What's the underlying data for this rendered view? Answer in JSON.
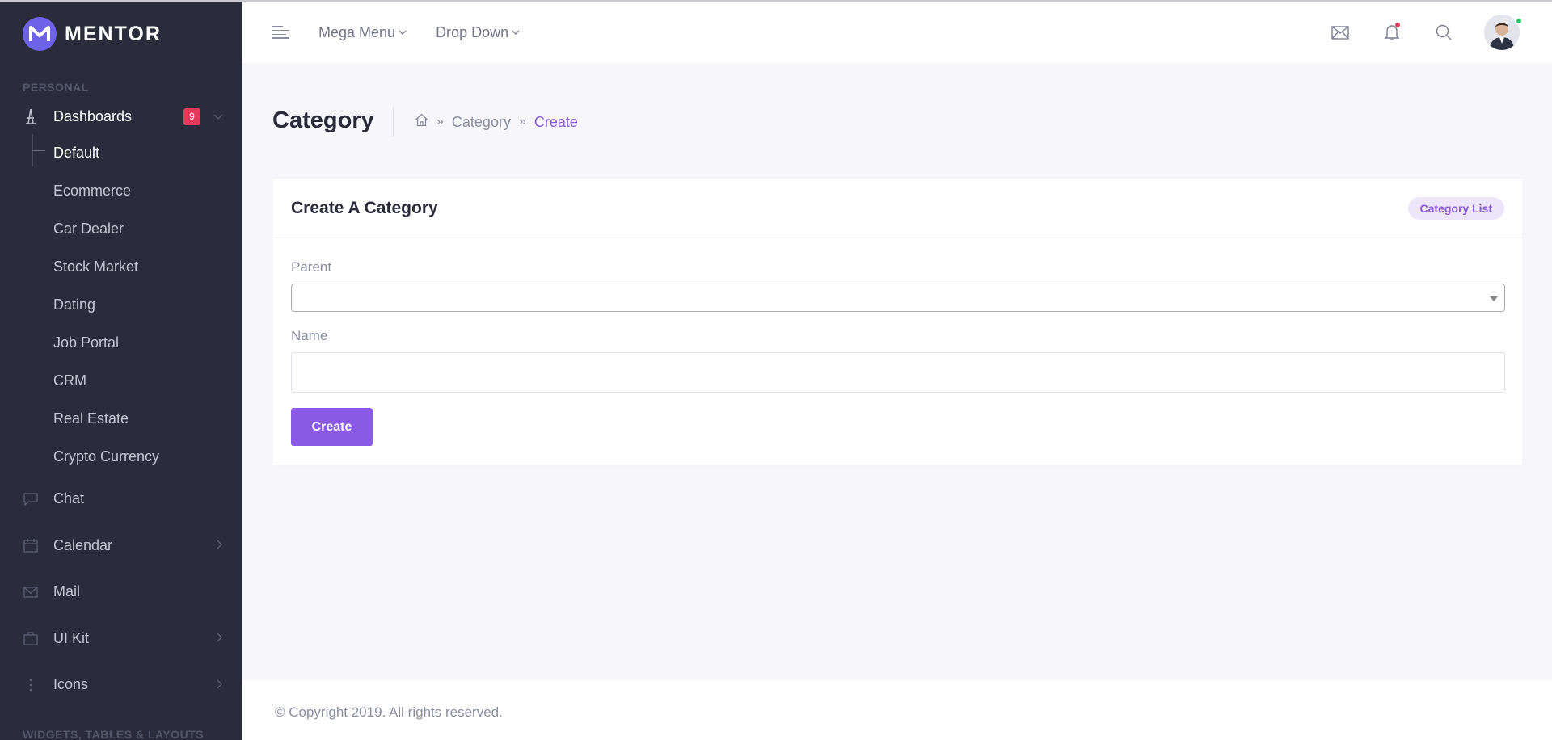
{
  "brand": {
    "name": "MENTOR"
  },
  "sidebar": {
    "section_personal": "PERSONAL",
    "dashboards": {
      "label": "Dashboards",
      "badge": "9"
    },
    "sub_items": [
      "Default",
      "Ecommerce",
      "Car Dealer",
      "Stock Market",
      "Dating",
      "Job Portal",
      "CRM",
      "Real Estate",
      "Crypto Currency"
    ],
    "items": [
      {
        "label": "Chat",
        "icon": "chat-icon"
      },
      {
        "label": "Calendar",
        "icon": "calendar-icon"
      },
      {
        "label": "Mail",
        "icon": "mail-icon"
      },
      {
        "label": "UI Kit",
        "icon": "bag-icon"
      },
      {
        "label": "Icons",
        "icon": "dots-icon"
      }
    ],
    "section_widgets": "WIDGETS, TABLES & LAYOUTS"
  },
  "topbar": {
    "menu1": "Mega Menu",
    "menu2": "Drop Down"
  },
  "page": {
    "title": "Category",
    "breadcrumb": {
      "level1": "Category",
      "current": "Create"
    }
  },
  "card": {
    "title": "Create A Category",
    "list_button": "Category List",
    "parent_label": "Parent",
    "parent_value": "",
    "name_label": "Name",
    "name_value": "",
    "submit": "Create"
  },
  "footer": {
    "text": "© Copyright 2019. All rights reserved."
  },
  "colors": {
    "accent": "#8a59e6",
    "sidebar_bg": "#2a2c3c",
    "badge": "#e53959",
    "online": "#29c36a"
  }
}
